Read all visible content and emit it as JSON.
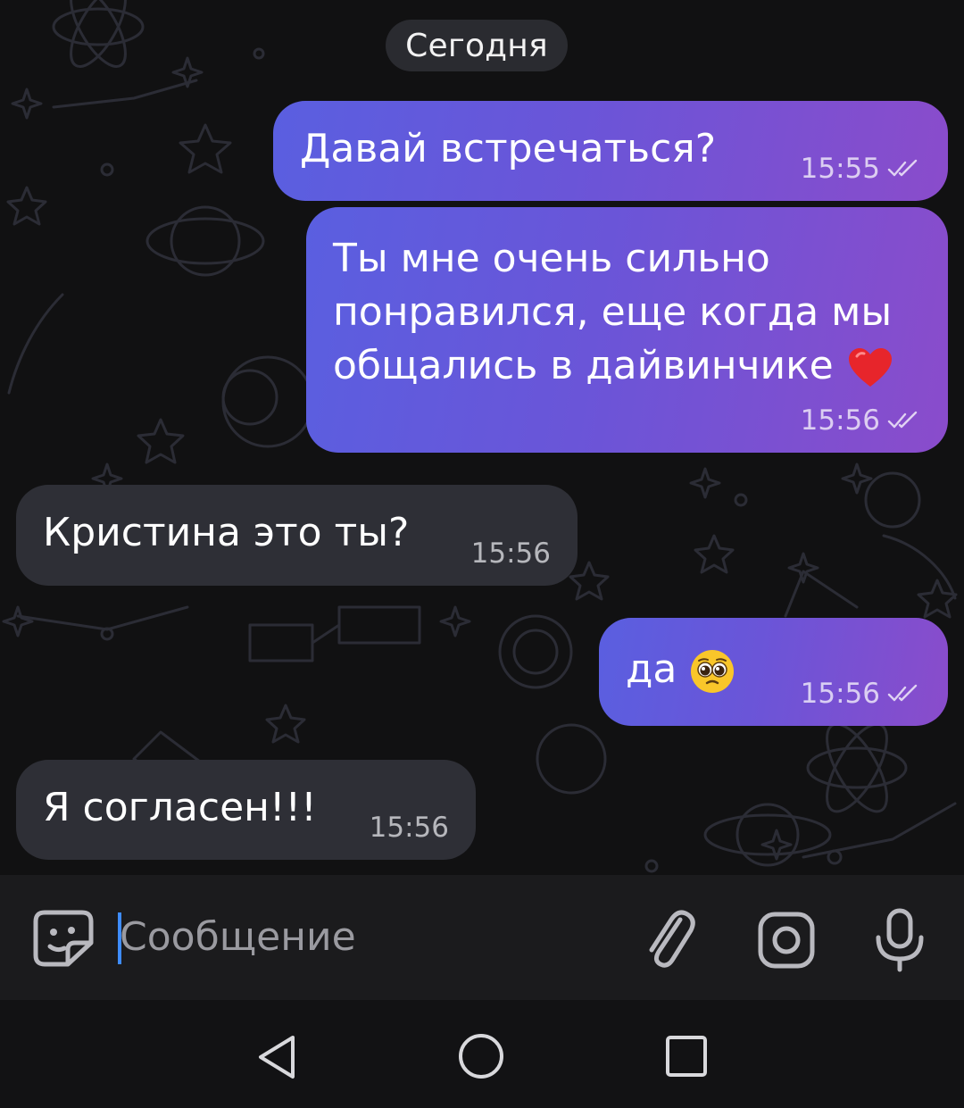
{
  "chat": {
    "date_separator": "Сегодня",
    "messages": [
      {
        "direction": "outgoing",
        "text": "Давай встречаться?",
        "time": "15:55",
        "status": "read"
      },
      {
        "direction": "outgoing",
        "lines": [
          "Ты мне очень сильно",
          "понравился, еще когда мы",
          "общались в дайвинчике"
        ],
        "emoji": "heart",
        "time": "15:56",
        "status": "read"
      },
      {
        "direction": "incoming",
        "text": "Кристина это ты?",
        "time": "15:56"
      },
      {
        "direction": "outgoing",
        "text": "да",
        "emoji": "pleading-face",
        "time": "15:56",
        "status": "read"
      },
      {
        "direction": "incoming",
        "text": "Я согласен!!!",
        "time": "15:56"
      }
    ]
  },
  "composer": {
    "placeholder": "Сообщение",
    "left_icon": "sticker-icon",
    "right_icons": [
      "paperclip-icon",
      "camera-icon",
      "microphone-icon"
    ]
  },
  "navbar": {
    "icons": [
      "back-icon",
      "home-icon",
      "recents-icon"
    ]
  },
  "colors": {
    "background": "#111112",
    "outgoing_start": "#5a5fe0",
    "outgoing_end": "#8a4ccb",
    "incoming": "#2e2f36",
    "caret": "#3e8cff"
  }
}
